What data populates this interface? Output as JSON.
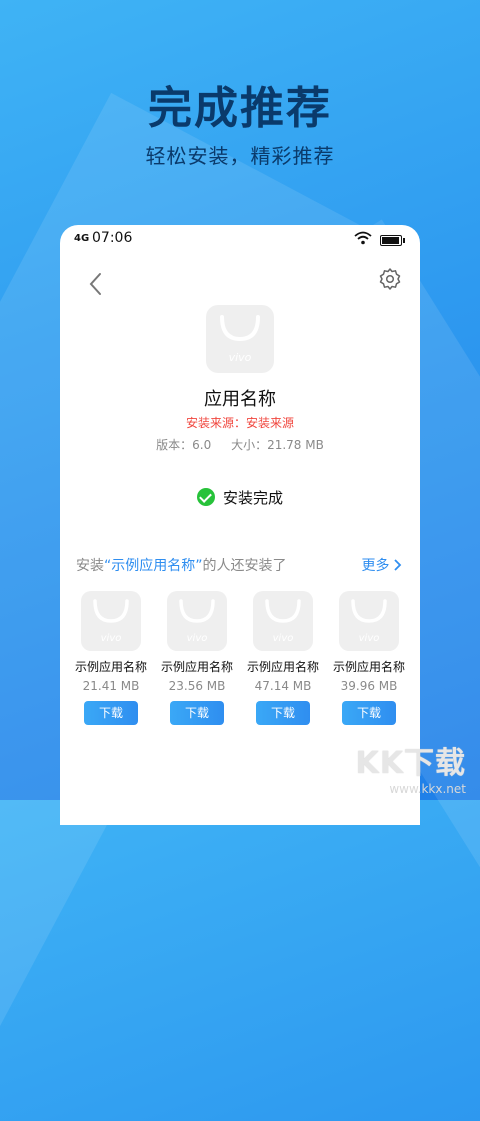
{
  "hero": {
    "title": "完成推荐",
    "subtitle": "轻松安装，精彩推荐"
  },
  "status_bar": {
    "signal": "4G",
    "time": "07:06"
  },
  "app": {
    "icon_label": "vivo",
    "name": "应用名称",
    "source": "安装来源：安装来源",
    "version": "版本：6.0",
    "size": "大小：21.78 MB",
    "install_status": "安装完成"
  },
  "recommend": {
    "prefix": "安装",
    "quoted_name": "“示例应用名称”",
    "suffix": "的人还安装了",
    "more": "更多",
    "items": [
      {
        "icon_label": "vivo",
        "name": "示例应用名称",
        "size": "21.41 MB",
        "button": "下载"
      },
      {
        "icon_label": "vivo",
        "name": "示例应用名称",
        "size": "23.56 MB",
        "button": "下载"
      },
      {
        "icon_label": "vivo",
        "name": "示例应用名称",
        "size": "47.14 MB",
        "button": "下载"
      },
      {
        "icon_label": "vivo",
        "name": "示例应用名称",
        "size": "39.96 MB",
        "button": "下载"
      }
    ]
  },
  "watermark": {
    "brand": "KK下载",
    "url": "www.kkx.net"
  },
  "colors": {
    "accent": "#2f8ef0",
    "success": "#27c23a",
    "warning": "#f0463e",
    "title": "#0a3a6b"
  },
  "icons": [
    "back-icon",
    "gear-icon",
    "wifi-icon",
    "battery-icon",
    "check-circle-icon",
    "chevron-right-icon",
    "bag-icon"
  ]
}
